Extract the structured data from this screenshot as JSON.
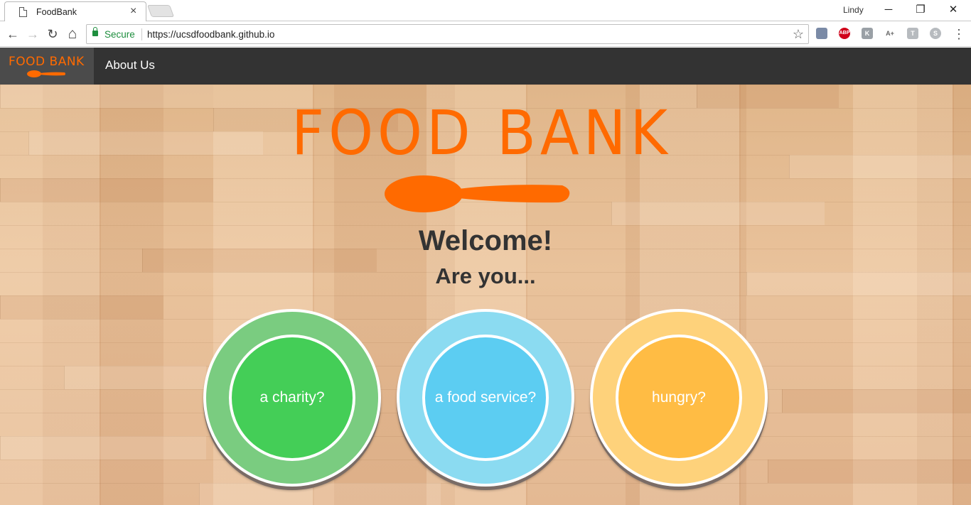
{
  "browser": {
    "tab_title": "FoodBank",
    "tab_close": "×",
    "profile_name": "Lindy",
    "window_controls": {
      "minimize": "─",
      "restore": "❐",
      "close": "✕"
    },
    "nav": {
      "back": "←",
      "forward": "→",
      "reload": "↻",
      "home": "⌂"
    },
    "secure_label": "Secure",
    "url": "https://ucsdfoodbank.github.io",
    "bookmark_star": "☆",
    "menu": "⋮",
    "extensions": [
      {
        "name": "ext-icon",
        "glyph": "",
        "color": "#7a8aa6"
      },
      {
        "name": "adblock-icon",
        "glyph": "ABP",
        "color": "#d0021b"
      },
      {
        "name": "ext-icon",
        "glyph": "K",
        "color": "#9aa0a6"
      },
      {
        "name": "ext-icon",
        "glyph": "A+",
        "color": "#ffffff"
      },
      {
        "name": "ext-icon",
        "glyph": "T",
        "color": "#b7bbbf"
      },
      {
        "name": "skype-icon",
        "glyph": "S",
        "color": "#b7bbbf"
      }
    ]
  },
  "navbar": {
    "logo_text": "FOOD BANK",
    "about_label": "About Us"
  },
  "hero": {
    "brand_title": "FOOD BANK",
    "welcome": "Welcome!",
    "question": "Are you...",
    "options": [
      {
        "label": "a charity?",
        "outer_color": "#7acc80",
        "inner_color": "#44ce57"
      },
      {
        "label": "a food service?",
        "outer_color": "#8bdbf1",
        "inner_color": "#5ccdf2"
      },
      {
        "label": "hungry?",
        "outer_color": "#fed27b",
        "inner_color": "#ffbc44"
      }
    ]
  },
  "colors": {
    "brand_orange": "#ff6a00",
    "navbar": "#333333"
  }
}
